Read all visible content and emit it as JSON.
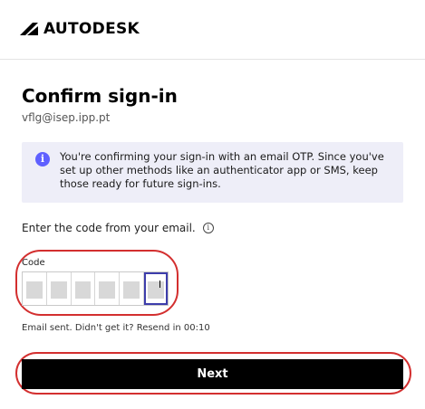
{
  "brand": {
    "name": "AUTODESK"
  },
  "page": {
    "title": "Confirm sign-in",
    "email": "vflg@isep.ipp.pt"
  },
  "info": {
    "icon": "info-icon",
    "text": "You're confirming your sign-in with an email OTP. Since you've set up other methods like an authenticator app or SMS, keep those ready for future sign-ins."
  },
  "prompt": {
    "text": "Enter the code from your email.",
    "icon": "info-circle-icon"
  },
  "code": {
    "label": "Code",
    "digit_count": 6,
    "active_index": 5
  },
  "resend": {
    "text": "Email sent. Didn't get it? Resend in 00:10"
  },
  "actions": {
    "next_label": "Next"
  },
  "colors": {
    "accent": "#5f60ff",
    "info_bg": "#eeeef8",
    "button_bg": "#000000",
    "annotation": "#d32f2f"
  }
}
